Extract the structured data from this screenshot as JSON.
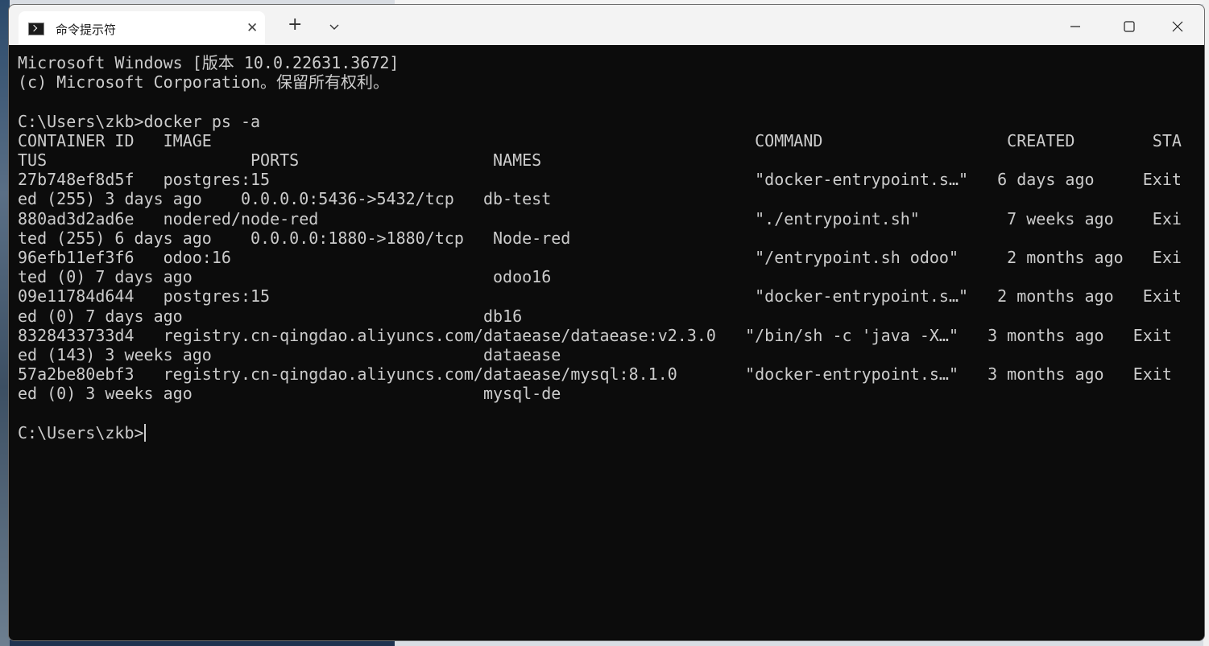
{
  "window": {
    "tab_title": "命令提示符",
    "tab_close_glyph": "✕",
    "new_tab_glyph": "+"
  },
  "terminal": {
    "lines": [
      "Microsoft Windows [版本 10.0.22631.3672]",
      "(c) Microsoft Corporation。保留所有权利。",
      "",
      "C:\\Users\\zkb>docker ps -a",
      "CONTAINER ID   IMAGE                                                        COMMAND                   CREATED        STA",
      "TUS                     PORTS                    NAMES",
      "27b748ef8d5f   postgres:15                                                  \"docker-entrypoint.s…\"   6 days ago     Exit",
      "ed (255) 3 days ago    0.0.0.0:5436->5432/tcp   db-test",
      "880ad3d2ad6e   nodered/node-red                                             \"./entrypoint.sh\"         7 weeks ago    Exi",
      "ted (255) 6 days ago    0.0.0.0:1880->1880/tcp   Node-red",
      "96efb11ef3f6   odoo:16                                                      \"/entrypoint.sh odoo\"     2 months ago   Exi",
      "ted (0) 7 days ago                               odoo16",
      "09e11784d644   postgres:15                                                  \"docker-entrypoint.s…\"   2 months ago   Exit",
      "ed (0) 7 days ago                               db16",
      "8328433733d4   registry.cn-qingdao.aliyuncs.com/dataease/dataease:v2.3.0   \"/bin/sh -c 'java -X…\"   3 months ago   Exit",
      "ed (143) 3 weeks ago                            dataease",
      "57a2be80ebf3   registry.cn-qingdao.aliyuncs.com/dataease/mysql:8.1.0       \"docker-entrypoint.s…\"   3 months ago   Exit",
      "ed (0) 3 weeks ago                              mysql-de",
      "",
      "C:\\Users\\zkb>"
    ]
  },
  "colors": {
    "terminal_bg": "#0c0c0c",
    "terminal_fg": "#cccccc",
    "titlebar_bg": "#f3f3f3",
    "tab_bg": "#ffffff"
  },
  "icons": {
    "tab": "terminal-icon",
    "dropdown": "chevron-down-icon",
    "minimize": "minimize-icon",
    "maximize": "maximize-icon",
    "close": "close-icon"
  }
}
